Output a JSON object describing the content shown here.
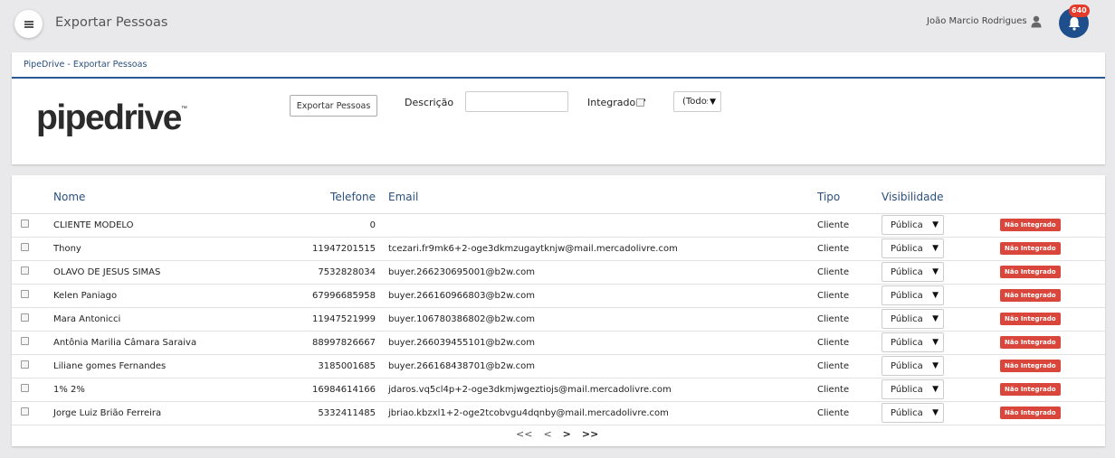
{
  "header": {
    "title": "Exportar Pessoas",
    "user_name": "João Marcio Rodrigues",
    "notification_count": "640"
  },
  "panel": {
    "heading": "PipeDrive - Exportar Pessoas",
    "logo_text": "pipedrive",
    "logo_tm": "™",
    "export_button": "Exportar Pessoas",
    "descricao_label": "Descrição",
    "descricao_value": "",
    "integrados_label": "Integrados?",
    "integrados_select": "(Todos)"
  },
  "table": {
    "headers": {
      "nome": "Nome",
      "telefone": "Telefone",
      "email": "Email",
      "tipo": "Tipo",
      "visibilidade": "Visibilidade"
    },
    "rows": [
      {
        "nome": "CLIENTE MODELO",
        "telefone": "0",
        "email": "",
        "tipo": "Cliente",
        "visibilidade": "Pública",
        "status": "Não Integrado"
      },
      {
        "nome": "Thony",
        "telefone": "11947201515",
        "email": "tcezari.fr9mk6+2-oge3dkmzugaytknjw@mail.mercadolivre.com",
        "tipo": "Cliente",
        "visibilidade": "Pública",
        "status": "Não Integrado"
      },
      {
        "nome": "OLAVO DE JESUS SIMAS",
        "telefone": "7532828034",
        "email": "buyer.266230695001@b2w.com",
        "tipo": "Cliente",
        "visibilidade": "Pública",
        "status": "Não Integrado"
      },
      {
        "nome": "Kelen Paniago",
        "telefone": "67996685958",
        "email": "buyer.266160966803@b2w.com",
        "tipo": "Cliente",
        "visibilidade": "Pública",
        "status": "Não Integrado"
      },
      {
        "nome": "Mara Antonicci",
        "telefone": "11947521999",
        "email": "buyer.106780386802@b2w.com",
        "tipo": "Cliente",
        "visibilidade": "Pública",
        "status": "Não Integrado"
      },
      {
        "nome": "Antônia Marilia Câmara Saraiva",
        "telefone": "88997826667",
        "email": "buyer.266039455101@b2w.com",
        "tipo": "Cliente",
        "visibilidade": "Pública",
        "status": "Não Integrado"
      },
      {
        "nome": "Liliane gomes Fernandes",
        "telefone": "3185001685",
        "email": "buyer.266168438701@b2w.com",
        "tipo": "Cliente",
        "visibilidade": "Pública",
        "status": "Não Integrado"
      },
      {
        "nome": "1% 2%",
        "telefone": "16984614166",
        "email": "jdaros.vq5cl4p+2-oge3dkmjwgeztiojs@mail.mercadolivre.com",
        "tipo": "Cliente",
        "visibilidade": "Pública",
        "status": "Não Integrado"
      },
      {
        "nome": "Jorge Luiz Brião Ferreira",
        "telefone": "5332411485",
        "email": "jbriao.kbzxl1+2-oge2tcobvgu4dqnby@mail.mercadolivre.com",
        "tipo": "Cliente",
        "visibilidade": "Pública",
        "status": "Não Integrado"
      }
    ]
  },
  "pagination": {
    "first": "<<",
    "prev": "<",
    "next": ">",
    "last": ">>"
  },
  "colors": {
    "accent": "#2b5797",
    "bell": "#1f4e8c",
    "badge": "#d9463c"
  }
}
